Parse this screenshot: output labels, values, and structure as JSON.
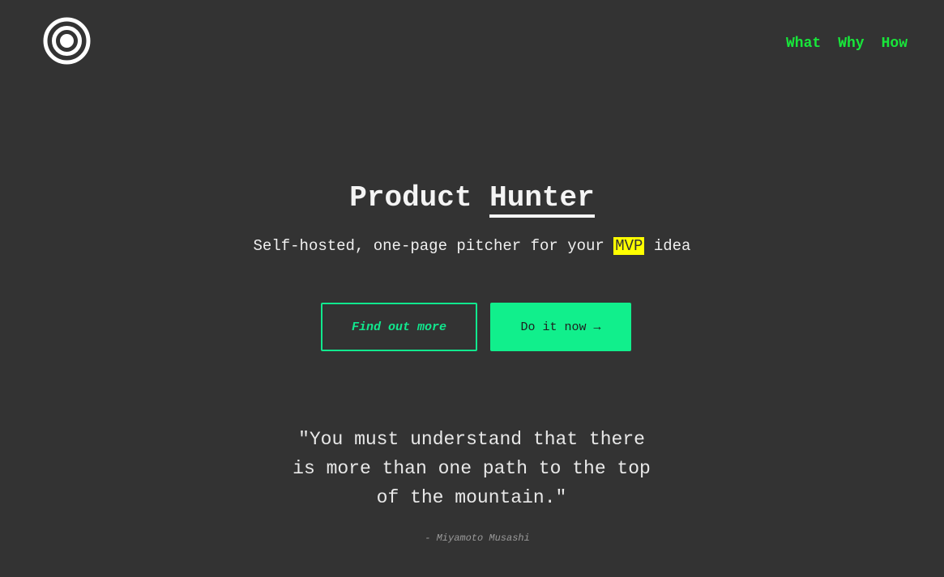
{
  "header": {
    "logo_icon": "concentric-circles-logo",
    "nav": [
      {
        "label": "What"
      },
      {
        "label": "Why"
      },
      {
        "label": "How"
      }
    ]
  },
  "hero": {
    "title_part1": "Product",
    "title_part2": "Hunter",
    "subtitle_before": "Self-hosted, one-page pitcher for your",
    "subtitle_highlight": "MVP",
    "subtitle_after": "idea"
  },
  "buttons": {
    "secondary_label": "Find out more",
    "primary_label": "Do it now →"
  },
  "quote": {
    "text": "\"You must understand that there is more than one path to the top of the mountain.\"",
    "author": "- Miyamoto Musashi"
  },
  "colors": {
    "background": "#333333",
    "nav_accent": "#18e63a",
    "button_accent": "#11ef8c",
    "highlight": "#ffff00"
  }
}
